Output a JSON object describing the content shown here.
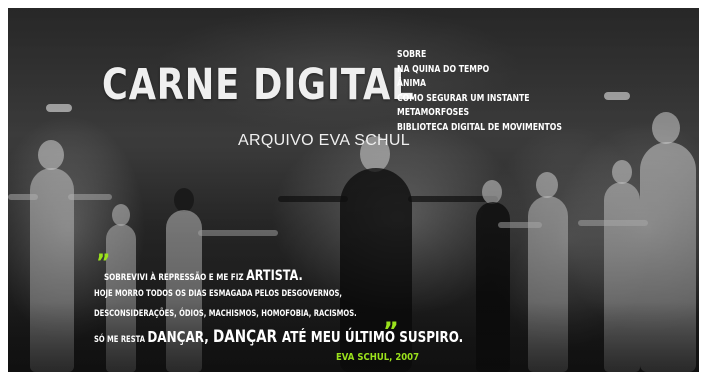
{
  "site": {
    "title": "CARNE DIGITAL",
    "subtitle": "ARQUIVO EVA SCHUL"
  },
  "nav": {
    "items": [
      "SOBRE",
      "NA QUINA DO TEMPO",
      "ÂNIMA",
      "COMO SEGURAR UM INSTANTE",
      "METAMORFOSES",
      "BIBLIOTECA DIGITAL DE MOVIMENTOS"
    ]
  },
  "quote": {
    "line1": {
      "prefix": "SOBREVIVI À REPRESSÃO E ME FIZ ",
      "emphasis": "ARTISTA."
    },
    "line2": "HOJE MORRO TODOS OS DIAS ESMAGADA PELOS DESGOVERNOS,",
    "line3": "DESCONSIDERAÇÕES, ÓDIOS, MACHISMOS, HOMOFOBIA, RACISMOS.",
    "line4": {
      "prefix": "SÓ ME RESTA ",
      "w1": "DANÇAR, ",
      "w2": "DANÇAR ",
      "w3": "ATÉ ",
      "w4": "MEU ",
      "w5": "ÚLTIMO ",
      "w6": "SUSPIRO."
    },
    "open_mark": "”",
    "close_mark": "”",
    "attribution": "EVA SCHUL, 2007"
  },
  "colors": {
    "accent": "#9be21c",
    "text": "#ffffff"
  }
}
